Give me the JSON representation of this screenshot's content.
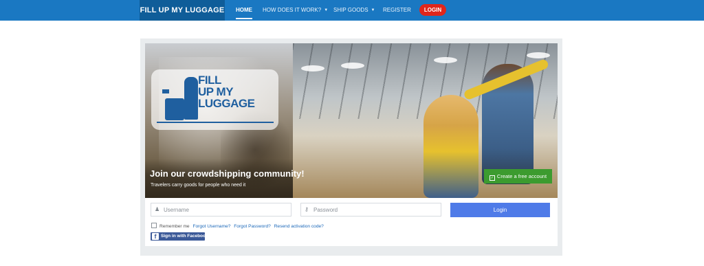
{
  "nav": {
    "brand": "FILL UP MY LUGGAGE",
    "items": [
      {
        "label": "HOME",
        "active": true
      },
      {
        "label": "HOW DOES IT WORK?",
        "has_dropdown": true
      },
      {
        "label": "SHIP GOODS",
        "has_dropdown": true
      },
      {
        "label": "REGISTER"
      }
    ],
    "login_label": "LOGIN"
  },
  "hero": {
    "logo_text_lines": [
      "FILL",
      "UP MY",
      "LUGGAGE"
    ],
    "title": "Join our crowdshipping community!",
    "subtitle": "Travelers carry goods for people who need it",
    "create_account_label": "Create a free account"
  },
  "form": {
    "username_placeholder": "Username",
    "password_placeholder": "Password",
    "login_label": "Login",
    "remember_label": "Remember me",
    "forgot_username": "Forgot Username?",
    "forgot_password": "Forgot Password?",
    "resend_activation": "Resend activation code?",
    "facebook_label": "Sign in with Facebook"
  },
  "colors": {
    "nav_bg": "#1a78c2",
    "brand_bg": "#0f5d99",
    "login_pill": "#e0261b",
    "create_account_btn": "#3c9b2f",
    "login_btn": "#4f7be8",
    "facebook": "#3b5998",
    "link": "#1a67b8"
  },
  "icons": {
    "username": "user-icon",
    "password": "key-icon",
    "create_account": "checkbox-icon",
    "facebook": "facebook-icon"
  }
}
